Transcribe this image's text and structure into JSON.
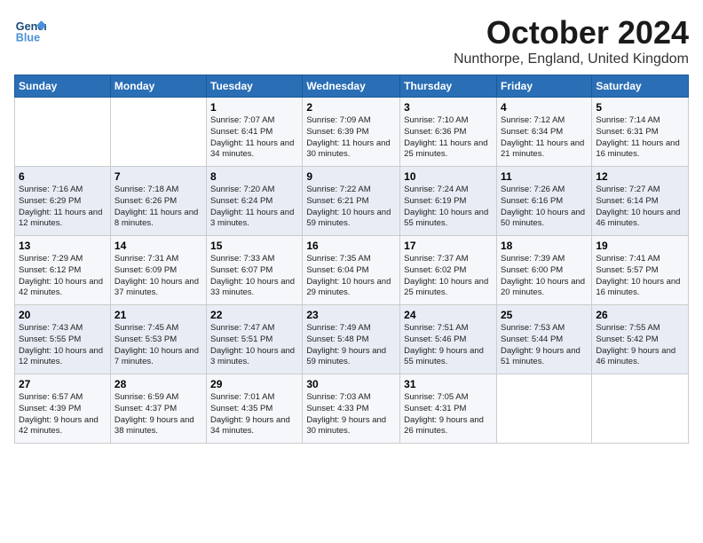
{
  "header": {
    "logo_line1": "General",
    "logo_line2": "Blue",
    "month_title": "October 2024",
    "location": "Nunthorpe, England, United Kingdom"
  },
  "days_of_week": [
    "Sunday",
    "Monday",
    "Tuesday",
    "Wednesday",
    "Thursday",
    "Friday",
    "Saturday"
  ],
  "weeks": [
    [
      {
        "day": "",
        "sunrise": "",
        "sunset": "",
        "daylight": ""
      },
      {
        "day": "",
        "sunrise": "",
        "sunset": "",
        "daylight": ""
      },
      {
        "day": "1",
        "sunrise": "Sunrise: 7:07 AM",
        "sunset": "Sunset: 6:41 PM",
        "daylight": "Daylight: 11 hours and 34 minutes."
      },
      {
        "day": "2",
        "sunrise": "Sunrise: 7:09 AM",
        "sunset": "Sunset: 6:39 PM",
        "daylight": "Daylight: 11 hours and 30 minutes."
      },
      {
        "day": "3",
        "sunrise": "Sunrise: 7:10 AM",
        "sunset": "Sunset: 6:36 PM",
        "daylight": "Daylight: 11 hours and 25 minutes."
      },
      {
        "day": "4",
        "sunrise": "Sunrise: 7:12 AM",
        "sunset": "Sunset: 6:34 PM",
        "daylight": "Daylight: 11 hours and 21 minutes."
      },
      {
        "day": "5",
        "sunrise": "Sunrise: 7:14 AM",
        "sunset": "Sunset: 6:31 PM",
        "daylight": "Daylight: 11 hours and 16 minutes."
      }
    ],
    [
      {
        "day": "6",
        "sunrise": "Sunrise: 7:16 AM",
        "sunset": "Sunset: 6:29 PM",
        "daylight": "Daylight: 11 hours and 12 minutes."
      },
      {
        "day": "7",
        "sunrise": "Sunrise: 7:18 AM",
        "sunset": "Sunset: 6:26 PM",
        "daylight": "Daylight: 11 hours and 8 minutes."
      },
      {
        "day": "8",
        "sunrise": "Sunrise: 7:20 AM",
        "sunset": "Sunset: 6:24 PM",
        "daylight": "Daylight: 11 hours and 3 minutes."
      },
      {
        "day": "9",
        "sunrise": "Sunrise: 7:22 AM",
        "sunset": "Sunset: 6:21 PM",
        "daylight": "Daylight: 10 hours and 59 minutes."
      },
      {
        "day": "10",
        "sunrise": "Sunrise: 7:24 AM",
        "sunset": "Sunset: 6:19 PM",
        "daylight": "Daylight: 10 hours and 55 minutes."
      },
      {
        "day": "11",
        "sunrise": "Sunrise: 7:26 AM",
        "sunset": "Sunset: 6:16 PM",
        "daylight": "Daylight: 10 hours and 50 minutes."
      },
      {
        "day": "12",
        "sunrise": "Sunrise: 7:27 AM",
        "sunset": "Sunset: 6:14 PM",
        "daylight": "Daylight: 10 hours and 46 minutes."
      }
    ],
    [
      {
        "day": "13",
        "sunrise": "Sunrise: 7:29 AM",
        "sunset": "Sunset: 6:12 PM",
        "daylight": "Daylight: 10 hours and 42 minutes."
      },
      {
        "day": "14",
        "sunrise": "Sunrise: 7:31 AM",
        "sunset": "Sunset: 6:09 PM",
        "daylight": "Daylight: 10 hours and 37 minutes."
      },
      {
        "day": "15",
        "sunrise": "Sunrise: 7:33 AM",
        "sunset": "Sunset: 6:07 PM",
        "daylight": "Daylight: 10 hours and 33 minutes."
      },
      {
        "day": "16",
        "sunrise": "Sunrise: 7:35 AM",
        "sunset": "Sunset: 6:04 PM",
        "daylight": "Daylight: 10 hours and 29 minutes."
      },
      {
        "day": "17",
        "sunrise": "Sunrise: 7:37 AM",
        "sunset": "Sunset: 6:02 PM",
        "daylight": "Daylight: 10 hours and 25 minutes."
      },
      {
        "day": "18",
        "sunrise": "Sunrise: 7:39 AM",
        "sunset": "Sunset: 6:00 PM",
        "daylight": "Daylight: 10 hours and 20 minutes."
      },
      {
        "day": "19",
        "sunrise": "Sunrise: 7:41 AM",
        "sunset": "Sunset: 5:57 PM",
        "daylight": "Daylight: 10 hours and 16 minutes."
      }
    ],
    [
      {
        "day": "20",
        "sunrise": "Sunrise: 7:43 AM",
        "sunset": "Sunset: 5:55 PM",
        "daylight": "Daylight: 10 hours and 12 minutes."
      },
      {
        "day": "21",
        "sunrise": "Sunrise: 7:45 AM",
        "sunset": "Sunset: 5:53 PM",
        "daylight": "Daylight: 10 hours and 7 minutes."
      },
      {
        "day": "22",
        "sunrise": "Sunrise: 7:47 AM",
        "sunset": "Sunset: 5:51 PM",
        "daylight": "Daylight: 10 hours and 3 minutes."
      },
      {
        "day": "23",
        "sunrise": "Sunrise: 7:49 AM",
        "sunset": "Sunset: 5:48 PM",
        "daylight": "Daylight: 9 hours and 59 minutes."
      },
      {
        "day": "24",
        "sunrise": "Sunrise: 7:51 AM",
        "sunset": "Sunset: 5:46 PM",
        "daylight": "Daylight: 9 hours and 55 minutes."
      },
      {
        "day": "25",
        "sunrise": "Sunrise: 7:53 AM",
        "sunset": "Sunset: 5:44 PM",
        "daylight": "Daylight: 9 hours and 51 minutes."
      },
      {
        "day": "26",
        "sunrise": "Sunrise: 7:55 AM",
        "sunset": "Sunset: 5:42 PM",
        "daylight": "Daylight: 9 hours and 46 minutes."
      }
    ],
    [
      {
        "day": "27",
        "sunrise": "Sunrise: 6:57 AM",
        "sunset": "Sunset: 4:39 PM",
        "daylight": "Daylight: 9 hours and 42 minutes."
      },
      {
        "day": "28",
        "sunrise": "Sunrise: 6:59 AM",
        "sunset": "Sunset: 4:37 PM",
        "daylight": "Daylight: 9 hours and 38 minutes."
      },
      {
        "day": "29",
        "sunrise": "Sunrise: 7:01 AM",
        "sunset": "Sunset: 4:35 PM",
        "daylight": "Daylight: 9 hours and 34 minutes."
      },
      {
        "day": "30",
        "sunrise": "Sunrise: 7:03 AM",
        "sunset": "Sunset: 4:33 PM",
        "daylight": "Daylight: 9 hours and 30 minutes."
      },
      {
        "day": "31",
        "sunrise": "Sunrise: 7:05 AM",
        "sunset": "Sunset: 4:31 PM",
        "daylight": "Daylight: 9 hours and 26 minutes."
      },
      {
        "day": "",
        "sunrise": "",
        "sunset": "",
        "daylight": ""
      },
      {
        "day": "",
        "sunrise": "",
        "sunset": "",
        "daylight": ""
      }
    ]
  ]
}
